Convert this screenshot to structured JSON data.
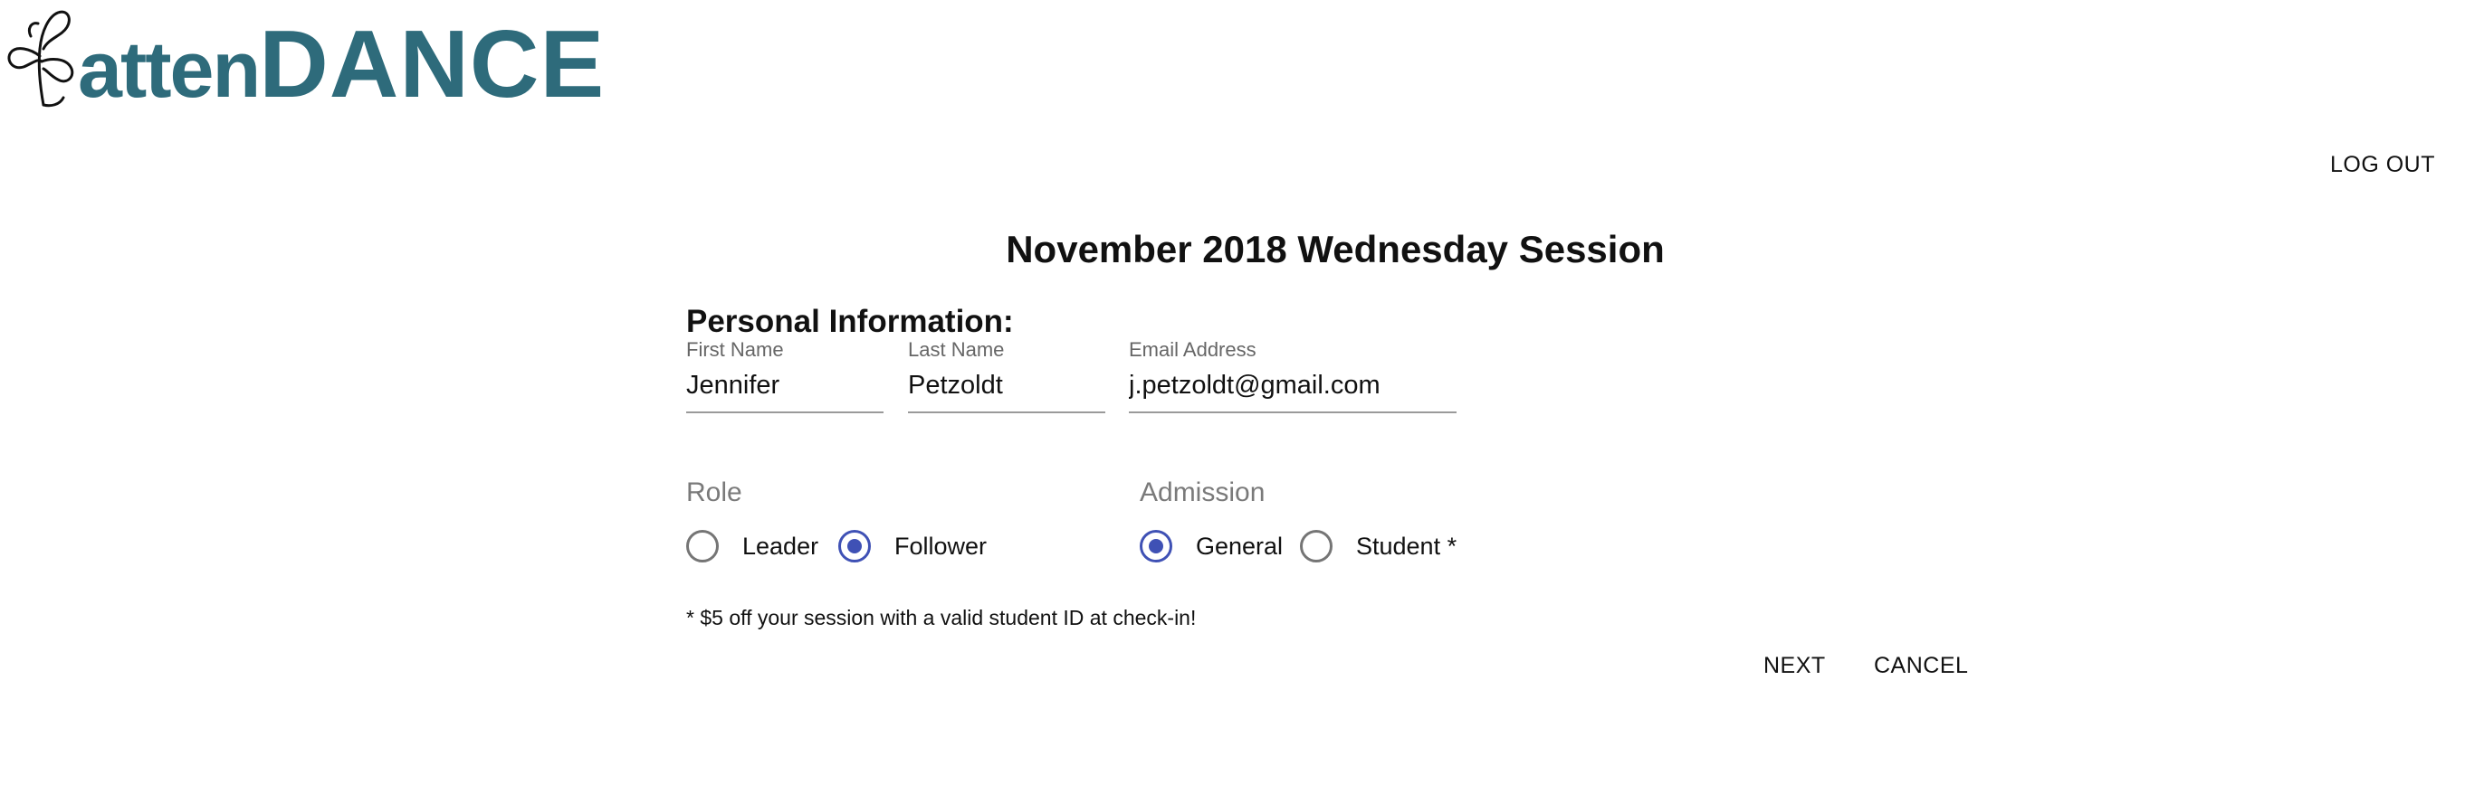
{
  "brand": {
    "logo_prefix": "atten",
    "logo_suffix": "DANCE",
    "logo_color": "#2e6b7b",
    "icon": "swirl-logo-icon"
  },
  "header": {
    "logout_label": "LOG OUT"
  },
  "form": {
    "title": "November 2018 Wednesday Session",
    "section_heading": "Personal Information:",
    "fields": {
      "first_name": {
        "label": "First Name",
        "value": "Jennifer"
      },
      "last_name": {
        "label": "Last Name",
        "value": "Petzoldt"
      },
      "email": {
        "label": "Email Address",
        "value": "j.petzoldt@gmail.com"
      }
    },
    "role": {
      "label": "Role",
      "options": [
        {
          "label": "Leader",
          "checked": false
        },
        {
          "label": "Follower",
          "checked": true
        }
      ]
    },
    "admission": {
      "label": "Admission",
      "options": [
        {
          "label": "General",
          "checked": true
        },
        {
          "label": "Student *",
          "checked": false
        }
      ]
    },
    "note": "* $5 off your session with a valid student ID at check-in!",
    "next_label": "NEXT",
    "cancel_label": "CANCEL"
  },
  "colors": {
    "accent": "#3f51b5",
    "unchecked": "#757575"
  }
}
